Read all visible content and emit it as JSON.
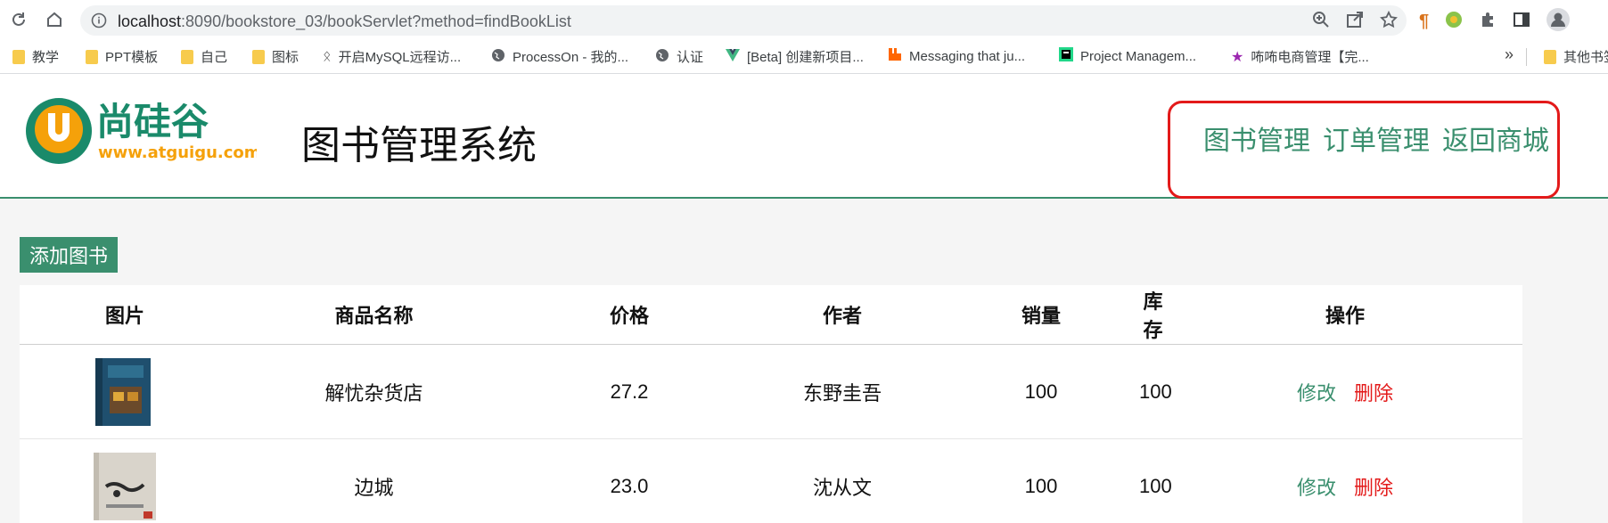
{
  "browser": {
    "url_host": "localhost",
    "url_rest": ":8090/bookstore_03/bookServlet?method=findBookList",
    "icons": [
      "reload-icon",
      "home-icon",
      "info-icon",
      "zoom-icon",
      "share-icon",
      "star-icon"
    ],
    "bookmarks": [
      {
        "label": "教学",
        "icon": "folder-icon"
      },
      {
        "label": "PPT模板",
        "icon": "folder-icon"
      },
      {
        "label": "自己",
        "icon": "folder-icon"
      },
      {
        "label": "图标",
        "icon": "folder-icon"
      },
      {
        "label": "开启MySQL远程访...",
        "icon": "mysql-icon"
      },
      {
        "label": "ProcessOn - 我的...",
        "icon": "globe-icon"
      },
      {
        "label": "认证",
        "icon": "globe-icon"
      },
      {
        "label": "[Beta] 创建新项目...",
        "icon": "vue-icon"
      },
      {
        "label": "Messaging that ju...",
        "icon": "rabbitmq-icon"
      },
      {
        "label": "Project Managem...",
        "icon": "pm-icon"
      },
      {
        "label": "咘咘电商管理【完...",
        "icon": "star-icon"
      }
    ],
    "overflow_label": "»",
    "other_bookmarks": "其他书签"
  },
  "header": {
    "title": "图书管理系统",
    "logo_text": "尚硅谷",
    "logo_url": "www.atguigu.com",
    "nav": [
      "图书管理",
      "订单管理",
      "返回商城"
    ],
    "accent_color": "#3a8f6e",
    "highlight_color": "#e31a1a"
  },
  "toolbar": {
    "add_label": "添加图书"
  },
  "table": {
    "columns": [
      "图片",
      "商品名称",
      "价格",
      "作者",
      "销量",
      "库存",
      "操作"
    ],
    "rows": [
      {
        "name": "解忧杂货店",
        "price": "27.2",
        "author": "东野圭吾",
        "sales": "100",
        "stock": "100",
        "edit": "修改",
        "delete": "删除"
      },
      {
        "name": "边城",
        "price": "23.0",
        "author": "沈从文",
        "sales": "100",
        "stock": "100",
        "edit": "修改",
        "delete": "删除"
      }
    ]
  }
}
